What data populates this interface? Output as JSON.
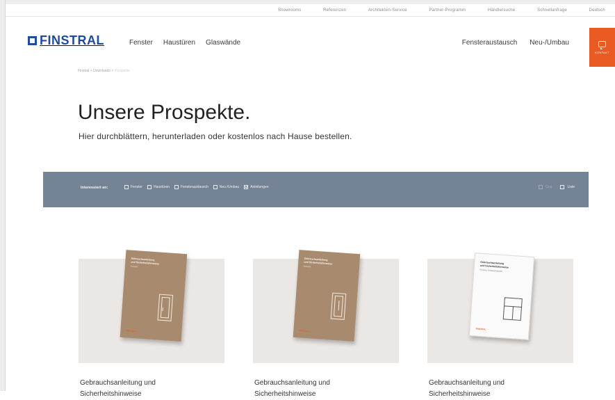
{
  "utility_nav": [
    "Showrooms",
    "Referenzen",
    "Architekten-Service",
    "Partner-Programm",
    "Händlersuche",
    "Schnellanfrage",
    "Deutsch"
  ],
  "logo": {
    "text": "FINSTRAL",
    "color": "#1e4c9a"
  },
  "main_nav": {
    "left": [
      "Fenster",
      "Haustüren",
      "Glaswände"
    ],
    "right": [
      "Fensteraustausch",
      "Neu-/Umbau"
    ]
  },
  "contact": {
    "label": "KONTAKT",
    "icon": "chat-bubble-icon",
    "color": "#ea5b24"
  },
  "breadcrumb": {
    "items": [
      "Finstral",
      "Downloads"
    ],
    "separator": ">",
    "current": "Prospekte"
  },
  "hero": {
    "title": "Unsere Prospekte.",
    "subtitle": "Hier durchblättern, herunterladen oder kostenlos nach Hause bestellen."
  },
  "filter": {
    "label": "Interessiert an:",
    "options": [
      {
        "label": "Fenster",
        "checked": false
      },
      {
        "label": "Haustüren",
        "checked": false
      },
      {
        "label": "Fensteraustausch",
        "checked": false
      },
      {
        "label": "Neu-/Umbau",
        "checked": false
      },
      {
        "label": "Anleitungen",
        "checked": true
      }
    ],
    "views": [
      {
        "label": "Grid",
        "active": false
      },
      {
        "label": "Liste",
        "active": true
      }
    ],
    "bar_color": "#758396"
  },
  "cards": [
    {
      "title": "Gebrauchsanleitung und",
      "title_line2": "Sicherheitshinweise",
      "cover": {
        "style": "brown",
        "heading": "Gebrauchsanleitung",
        "heading2": "und Sicherheitshinweise",
        "sub": "Haustür",
        "brand": "FINSTRAL",
        "icon": "door-icon"
      }
    },
    {
      "title": "Gebrauchsanleitung und",
      "title_line2": "Sicherheitshinweise",
      "cover": {
        "style": "brown",
        "heading": "Gebrauchsanleitung",
        "heading2": "und Sicherheitshinweise",
        "sub": "Haustür",
        "brand": "FINSTRAL",
        "icon": "door-icon"
      }
    },
    {
      "title": "Gebrauchsanleitung und",
      "title_line2": "Sicherheitshinweise",
      "cover": {
        "style": "white",
        "heading": "Gebrauchsanleitung",
        "heading2": "und Sicherheitshinweise",
        "sub": "Fenster, Hebeschiebetür",
        "brand": "FINSTRAL",
        "icon": "window-icon"
      }
    }
  ]
}
